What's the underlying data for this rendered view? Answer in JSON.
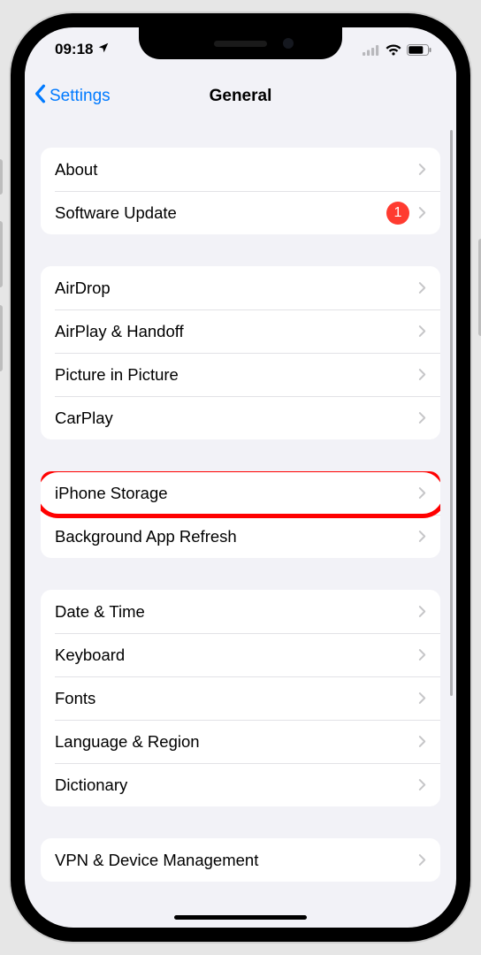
{
  "status": {
    "time": "09:18",
    "location_active": true
  },
  "nav": {
    "back_label": "Settings",
    "title": "General"
  },
  "groups": [
    {
      "rows": [
        {
          "id": "about",
          "label": "About",
          "badge": null,
          "highlighted": false
        },
        {
          "id": "software-update",
          "label": "Software Update",
          "badge": "1",
          "highlighted": false
        }
      ]
    },
    {
      "rows": [
        {
          "id": "airdrop",
          "label": "AirDrop",
          "badge": null,
          "highlighted": false
        },
        {
          "id": "airplay-handoff",
          "label": "AirPlay & Handoff",
          "badge": null,
          "highlighted": false
        },
        {
          "id": "picture-in-picture",
          "label": "Picture in Picture",
          "badge": null,
          "highlighted": false
        },
        {
          "id": "carplay",
          "label": "CarPlay",
          "badge": null,
          "highlighted": false
        }
      ]
    },
    {
      "rows": [
        {
          "id": "iphone-storage",
          "label": "iPhone Storage",
          "badge": null,
          "highlighted": true
        },
        {
          "id": "background-app-refresh",
          "label": "Background App Refresh",
          "badge": null,
          "highlighted": false
        }
      ]
    },
    {
      "rows": [
        {
          "id": "date-time",
          "label": "Date & Time",
          "badge": null,
          "highlighted": false
        },
        {
          "id": "keyboard",
          "label": "Keyboard",
          "badge": null,
          "highlighted": false
        },
        {
          "id": "fonts",
          "label": "Fonts",
          "badge": null,
          "highlighted": false
        },
        {
          "id": "language-region",
          "label": "Language & Region",
          "badge": null,
          "highlighted": false
        },
        {
          "id": "dictionary",
          "label": "Dictionary",
          "badge": null,
          "highlighted": false
        }
      ]
    },
    {
      "rows": [
        {
          "id": "vpn-device-management",
          "label": "VPN & Device Management",
          "badge": null,
          "highlighted": false
        }
      ]
    }
  ]
}
